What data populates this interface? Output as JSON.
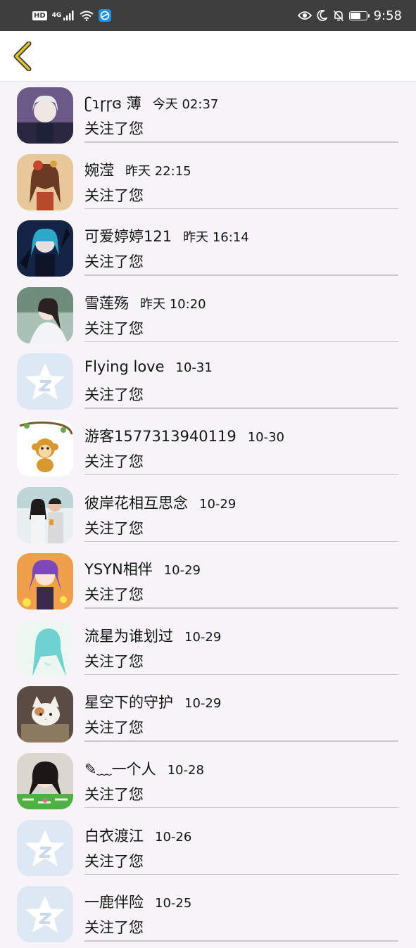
{
  "status_bar": {
    "hd": "HD",
    "network": "4G",
    "time": "9:58",
    "battery_level": 0.7,
    "icons": [
      "hd-badge",
      "signal-icon",
      "wifi-icon",
      "app-notification-icon",
      "eye-comfort-icon",
      "moon-icon",
      "bell-muted-icon",
      "battery-icon"
    ]
  },
  "nav": {
    "back_icon": "chevron-left-icon",
    "accent": "#e6c229"
  },
  "followers": [
    {
      "name": "ʗɿɼɼɞ 薄",
      "time": "今天 02:37",
      "action": "关注了您",
      "avatar": "anime-silver-hair"
    },
    {
      "name": "婉滢",
      "time": "昨天 22:15",
      "action": "关注了您",
      "avatar": "painted-girl"
    },
    {
      "name": "可爱婷婷121",
      "time": "昨天 16:14",
      "action": "关注了您",
      "avatar": "anime-dark-blue"
    },
    {
      "name": "雪莲殇",
      "time": "昨天 10:20",
      "action": "关注了您",
      "avatar": "woman-white"
    },
    {
      "name": "Flying love",
      "time": "10-31",
      "action": "关注了您",
      "avatar": "default-qq"
    },
    {
      "name": "游客1577313940119",
      "time": "10-30",
      "action": "关注了您",
      "avatar": "cartoon-monkey"
    },
    {
      "name": "彼岸花相互思念",
      "time": "10-29",
      "action": "关注了您",
      "avatar": "couple-photo"
    },
    {
      "name": "YSYN相伴",
      "time": "10-29",
      "action": "关注了您",
      "avatar": "anime-purple"
    },
    {
      "name": "流星为谁划过",
      "time": "10-29",
      "action": "关注了您",
      "avatar": "anime-cyan-hair"
    },
    {
      "name": "星空下的守护",
      "time": "10-29",
      "action": "关注了您",
      "avatar": "kitten"
    },
    {
      "name": "✎﹏一个人",
      "time": "10-28",
      "action": "关注了您",
      "avatar": "girl-green-banner"
    },
    {
      "name": "白衣渡江",
      "time": "10-26",
      "action": "关注了您",
      "avatar": "default-qq"
    },
    {
      "name": "一鹿伴险",
      "time": "10-25",
      "action": "关注了您",
      "avatar": "default-qq"
    }
  ]
}
